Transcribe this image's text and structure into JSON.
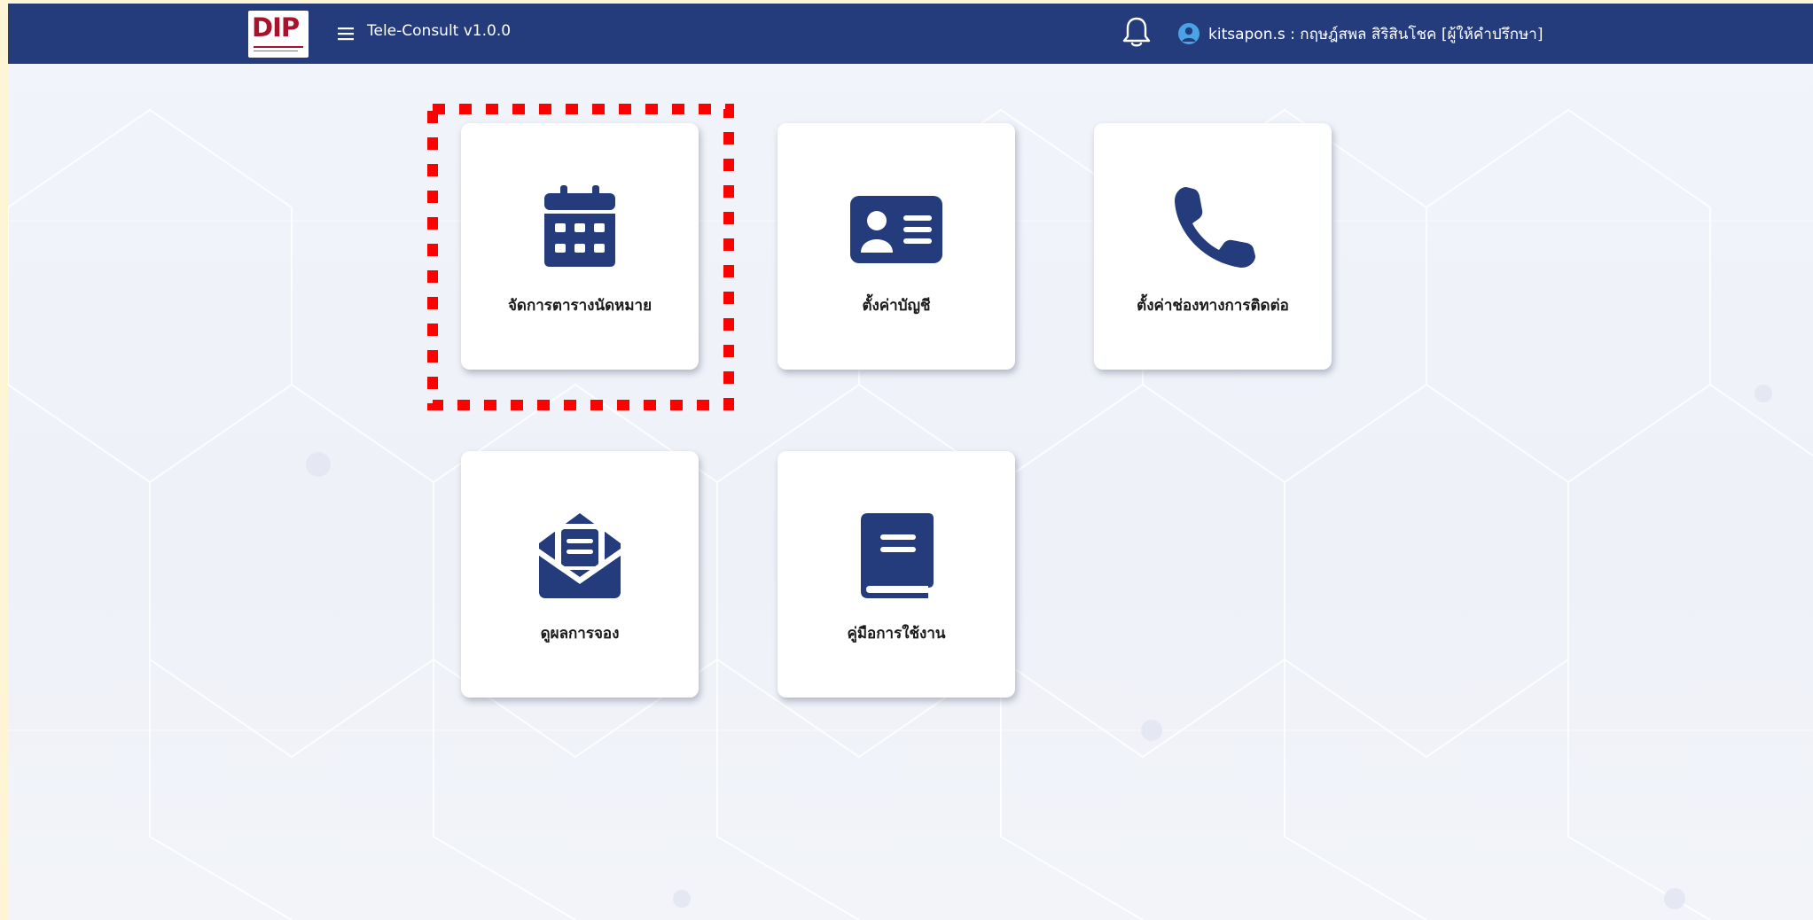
{
  "header": {
    "logo_text": "DIP",
    "app_title": "Tele-Consult v1.0.0",
    "user_label": "kitsapon.s : กฤษฎ์สพล สิริสินโชค [ผู้ให้คำปรึกษา]"
  },
  "tiles": [
    {
      "label": "จัดการตารางนัดหมาย",
      "icon": "calendar-icon"
    },
    {
      "label": "ตั้งค่าบัญชี",
      "icon": "id-card-icon"
    },
    {
      "label": "ตั้งค่าช่องทางการติดต่อ",
      "icon": "phone-icon"
    },
    {
      "label": "ดูผลการจอง",
      "icon": "envelope-open-text-icon"
    },
    {
      "label": "คู่มือการใช้งาน",
      "icon": "book-icon"
    }
  ],
  "colors": {
    "navbar": "#243b7c",
    "icon": "#243b7c",
    "highlight": "#ff0000",
    "avatar": "#4aa3e4"
  }
}
